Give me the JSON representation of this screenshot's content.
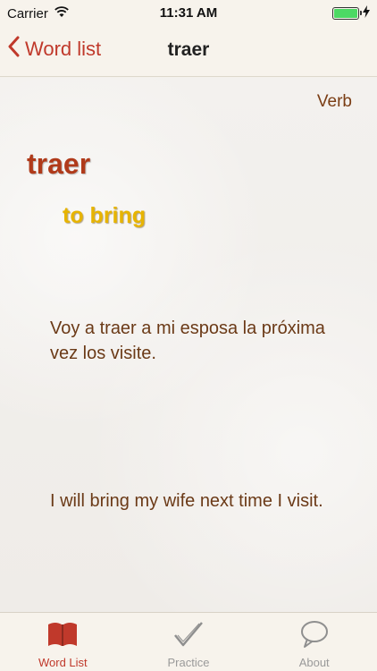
{
  "status_bar": {
    "carrier": "Carrier",
    "time": "11:31 AM",
    "battery_level": 1.0,
    "battery_color": "#4cd964"
  },
  "nav": {
    "back_label": "Word list",
    "title": "traer",
    "accent_color": "#c0392b"
  },
  "entry": {
    "part_of_speech": "Verb",
    "word": "traer",
    "translation": "to bring",
    "example_es": "Voy a traer a mi esposa la próxima vez los visite.",
    "example_en": "I will bring my wife next time I visit."
  },
  "tabs": [
    {
      "label": "Word List",
      "icon": "book-icon",
      "active": true
    },
    {
      "label": "Practice",
      "icon": "checkmark-icon",
      "active": false
    },
    {
      "label": "About",
      "icon": "speech-bubble-icon",
      "active": false
    }
  ]
}
